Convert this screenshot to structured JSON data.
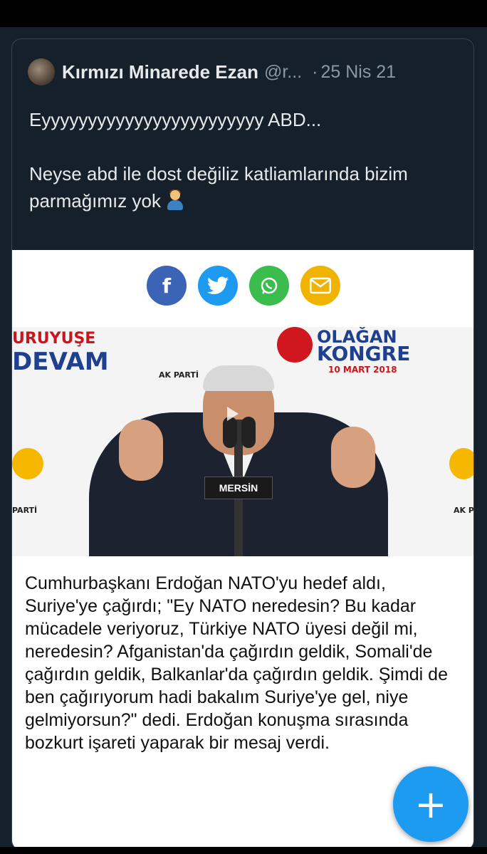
{
  "tweet": {
    "display_name": "Kırmızı Minarede Ezan",
    "handle": "@r...",
    "separator": "·",
    "date": "25 Nis 21",
    "text_line1": "Eyyyyyyyyyyyyyyyyyyyyyyyy ABD...",
    "text_line2": "Neyse abd ile dost değiliz katliamlarında bizim parmağımız yok",
    "emoji": "person-facepalming"
  },
  "embed": {
    "share_buttons": [
      {
        "name": "facebook",
        "glyph": "f",
        "color": "#3b63b6"
      },
      {
        "name": "twitter",
        "color": "#1d9bf0"
      },
      {
        "name": "whatsapp",
        "color": "#3bbd4e"
      },
      {
        "name": "email",
        "color": "#f0b400"
      }
    ],
    "photo": {
      "banner_left_1": "URUYUŞE",
      "banner_left_2": "DEVAM",
      "banner_center_1": "OLAĞAN",
      "banner_center_2": "KONGRE",
      "banner_date": "10 MART 2018",
      "party_label": "AK PARTİ",
      "party_label_left": "PARTİ",
      "party_label_right": "AK P",
      "podium": "MERSİN"
    },
    "article": "Cumhurbaşkanı Erdoğan NATO'yu hedef aldı, Suriye'ye çağırdı; \"Ey NATO neredesin? Bu kadar mücadele veriyoruz, Türkiye NATO üyesi değil mi, neredesin? Afganistan'da çağırdın geldik, Somali'de çağırdın geldik, Balkanlar'da çağırdın geldik. Şimdi de ben çağırıyorum hadi bakalım Suriye'ye gel, niye gelmiyorsun?\" dedi. Erdoğan konuşma sırasında bozkurt işareti yaparak bir mesaj verdi."
  },
  "fab": {
    "label": "+"
  },
  "colors": {
    "background": "#15202b",
    "accent": "#1d9bf0",
    "text": "#e7e9ea",
    "muted": "#8b98a5"
  }
}
